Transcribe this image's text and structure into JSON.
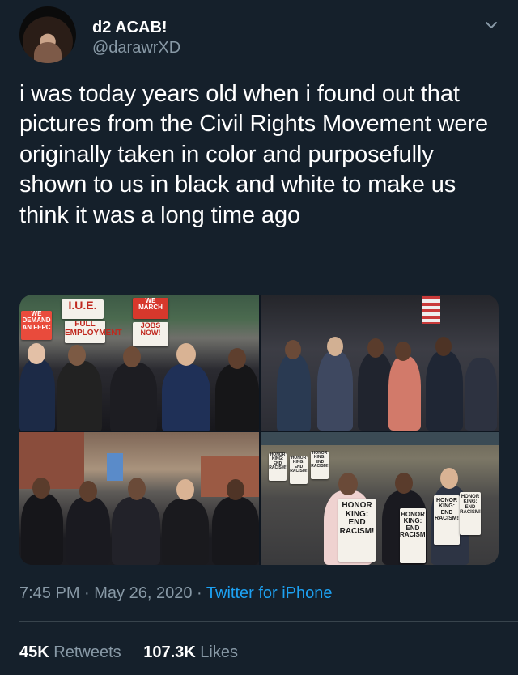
{
  "author": {
    "display_name": "d2 ACAB!",
    "handle": "@darawrXD",
    "avatar_icon": "avatar-photo"
  },
  "tweet": {
    "text": "i was today years old when i found out that pictures from the Civil Rights Movement were originally taken in color and purposefully shown to us in black and white to make us think it was a long time ago"
  },
  "media": {
    "photo1_signs": [
      "WE DEMAND",
      "AN FEPC",
      "I.U.E.",
      "FULL",
      "EMPLOYMENT",
      "WE MARCH",
      "JOBS",
      "NOW!"
    ],
    "photo4_signs": [
      "HONOR KING: END RACISM!",
      "HONOR KING: END RACISM!",
      "HONOR KING: END RACISM!"
    ]
  },
  "meta": {
    "time": "7:45 PM",
    "separator": " · ",
    "date": "May 26, 2020",
    "source": "Twitter for iPhone"
  },
  "stats": {
    "retweets_count": "45K",
    "retweets_label": "Retweets",
    "likes_count": "107.3K",
    "likes_label": "Likes"
  },
  "colors": {
    "background": "#15202b",
    "secondary_text": "#8899a6",
    "link": "#1da1f2"
  }
}
